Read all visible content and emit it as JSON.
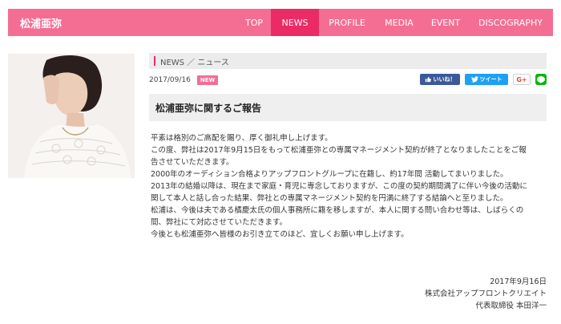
{
  "site": {
    "brand": "松浦亜弥"
  },
  "nav": {
    "items": [
      {
        "label": "TOP"
      },
      {
        "label": "NEWS"
      },
      {
        "label": "PROFILE"
      },
      {
        "label": "MEDIA"
      },
      {
        "label": "EVENT"
      },
      {
        "label": "DISCOGRAPHY"
      }
    ],
    "active": "NEWS"
  },
  "section": {
    "heading": "NEWS ／ ニュース"
  },
  "article": {
    "date": "2017/09/16",
    "badge": "NEW",
    "title": "松浦亜弥に関するご報告",
    "lines": [
      "平素は格別のご高配を賜り、厚く御礼申し上げます。",
      "この度、弊社は2017年9月15日をもって松浦亜弥との専属マネージメント契約が終了となりましたことをご報",
      "告させていただきます。",
      "2000年のオーディション合格よりアップフロントグループに在籍し、約17年間 活動してまいりました。",
      "2013年の結婚以降は、現在まで家庭・育児に専念しておりますが、この度の契約期間満了に伴い今後の活動に",
      "関して本人と話し合った結果、弊社との専属マネージメント契約を円満に終了する結論へと至りました。",
      "松浦は、今後は夫である橘慶太氏の個人事務所に籍を移しますが、本人に関する問い合わせ等は、しばらくの",
      "間、弊社にて対応させていただきます。",
      "今後とも松浦亜弥へ皆様のお引き立てのほど、宜しくお願い申し上げます。"
    ],
    "signature": {
      "date": "2017年9月16日",
      "company": "株式会社アップフロントクリエイト",
      "person": "代表取締役 本田洋一"
    }
  },
  "social": {
    "facebook": "いいね！",
    "twitter": "ツイート",
    "gplus": "G+",
    "line": "LINE"
  },
  "colors": {
    "primary": "#f46e94",
    "active": "#ea2b66",
    "facebook": "#3b5998",
    "twitter": "#1da1f2",
    "line": "#00b900"
  }
}
